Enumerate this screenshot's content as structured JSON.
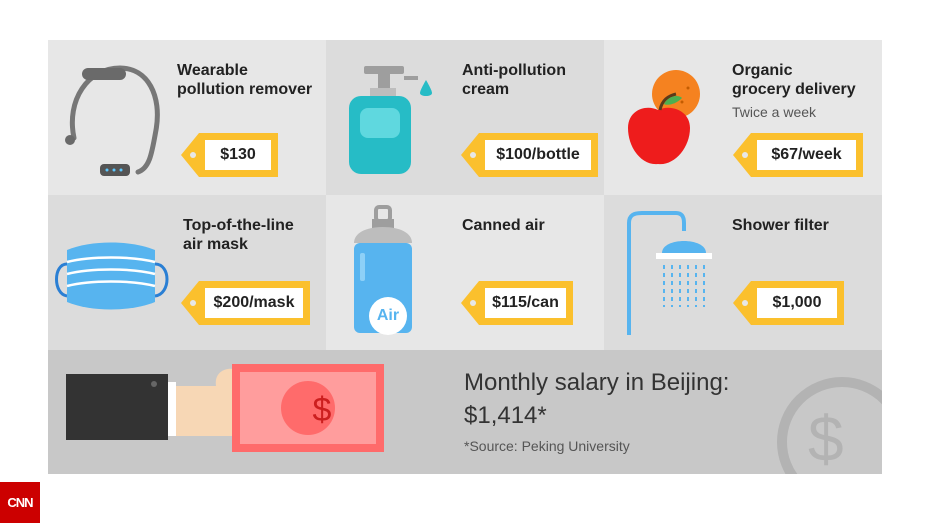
{
  "items": [
    {
      "title": "Wearable\npollution remover",
      "price": "$130"
    },
    {
      "title": "Anti-pollution\ncream",
      "price": "$100/bottle"
    },
    {
      "title": "Organic\ngrocery delivery",
      "subtitle": "Twice a week",
      "price": "$67/week"
    },
    {
      "title": "Top-of-the-line\nair mask",
      "price": "$200/mask"
    },
    {
      "title": "Canned air",
      "price": "$115/can",
      "can_label": "Air"
    },
    {
      "title": "Shower filter",
      "price": "$1,000"
    }
  ],
  "salary": {
    "headline": "Monthly salary in Beijing:\n$1,414*",
    "source": "*Source: Peking University",
    "currency_symbol": "$"
  },
  "brand": {
    "logo_text": "CNN"
  },
  "colors": {
    "tag": "#fbc02d",
    "teal": "#26bcc6",
    "blue": "#57b4ef",
    "red": "#e53935",
    "logo": "#cc0000"
  }
}
